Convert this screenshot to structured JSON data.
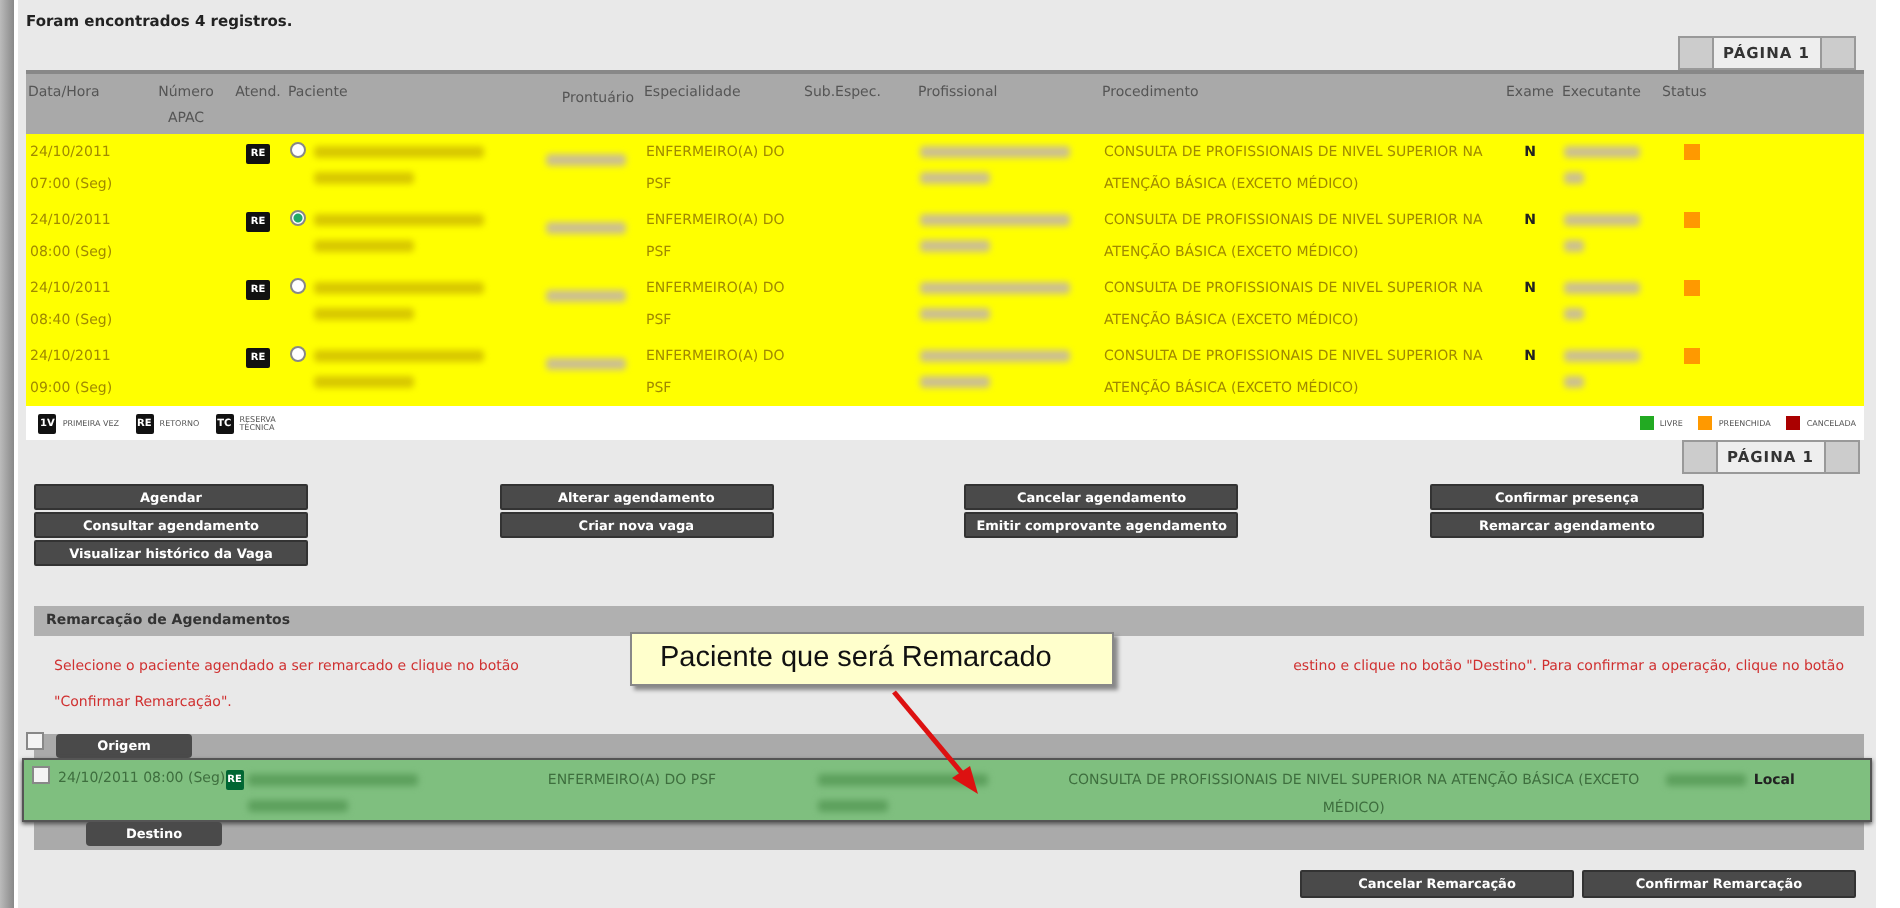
{
  "summary": "Foram encontrados 4 registros.",
  "pager_top": {
    "label": "PÁGINA 1"
  },
  "table": {
    "columns": [
      "Data/Hora",
      "Número APAC",
      "Atend.",
      "Paciente",
      "Prontuário",
      "Especialidade",
      "Sub.Espec.",
      "Profissional",
      "Procedimento",
      "Exame",
      "Executante",
      "Status"
    ],
    "rows": [
      {
        "datetime": "24/10/2011 07:00 (Seg)",
        "atend": "RE",
        "selected": false,
        "especialidade": "ENFERMEIRO(A) DO PSF",
        "procedimento": "CONSULTA DE PROFISSIONAIS DE NIVEL SUPERIOR NA ATENÇÃO BÁSICA (EXCETO MÉDICO)",
        "exame": "N",
        "color": "#ff9900"
      },
      {
        "datetime": "24/10/2011 08:00 (Seg)",
        "atend": "RE",
        "selected": true,
        "especialidade": "ENFERMEIRO(A) DO PSF",
        "procedimento": "CONSULTA DE PROFISSIONAIS DE NIVEL SUPERIOR NA ATENÇÃO BÁSICA (EXCETO MÉDICO)",
        "exame": "N",
        "color": "#ff9900"
      },
      {
        "datetime": "24/10/2011 08:40 (Seg)",
        "atend": "RE",
        "selected": false,
        "especialidade": "ENFERMEIRO(A) DO PSF",
        "procedimento": "CONSULTA DE PROFISSIONAIS DE NIVEL SUPERIOR NA ATENÇÃO BÁSICA (EXCETO MÉDICO)",
        "exame": "N",
        "color": "#ff9900"
      },
      {
        "datetime": "24/10/2011 09:00 (Seg)",
        "atend": "RE",
        "selected": false,
        "especialidade": "ENFERMEIRO(A) DO PSF",
        "procedimento": "CONSULTA DE PROFISSIONAIS DE NIVEL SUPERIOR NA ATENÇÃO BÁSICA (EXCETO MÉDICO)",
        "exame": "N",
        "color": "#ff9900"
      }
    ]
  },
  "legend_types": [
    {
      "badge": "1V",
      "label": "PRIMEIRA VEZ"
    },
    {
      "badge": "RE",
      "label": "RETORNO"
    },
    {
      "badge": "TC",
      "label": "RESERVA TÉCNICA"
    }
  ],
  "legend_status": [
    {
      "label": "LIVRE",
      "color": "#22aa22"
    },
    {
      "label": "PREENCHIDA",
      "color": "#ff9900"
    },
    {
      "label": "CANCELADA",
      "color": "#aa0000"
    }
  ],
  "pager_bottom": {
    "label": "PÁGINA 1"
  },
  "button_columns": [
    [
      "Agendar",
      "Consultar agendamento",
      "Visualizar histórico da Vaga"
    ],
    [
      "Alterar agendamento",
      "Criar nova vaga"
    ],
    [
      "Cancelar agendamento",
      "Emitir comprovante agendamento"
    ],
    [
      "Confirmar presença",
      "Remarcar agendamento"
    ]
  ],
  "remarcacao": {
    "title": "Remarcação de Agendamentos",
    "instruction_left": "Selecione o paciente agendado a ser remarcado e clique no botão",
    "instruction_right": "estino e clique no botão \"Destino\". Para confirmar a operação, clique no botão",
    "instruction_line2": "\"Confirmar Remarcação\".",
    "header_checked": false,
    "origem_label": "Origem",
    "row": {
      "checked": false,
      "datetime": "24/10/2011 08:00 (Seg)",
      "atend": "RE",
      "especialidade": "ENFERMEIRO(A) DO PSF",
      "procedimento": "CONSULTA DE PROFISSIONAIS DE NIVEL SUPERIOR NA ATENÇÃO BÁSICA (EXCETO MÉDICO)",
      "local": "Local"
    },
    "destino_label": "Destino",
    "buttons": [
      "Cancelar Remarcação",
      "Confirmar Remarcação"
    ]
  },
  "callout": {
    "text": "Paciente que será Remarcado"
  }
}
